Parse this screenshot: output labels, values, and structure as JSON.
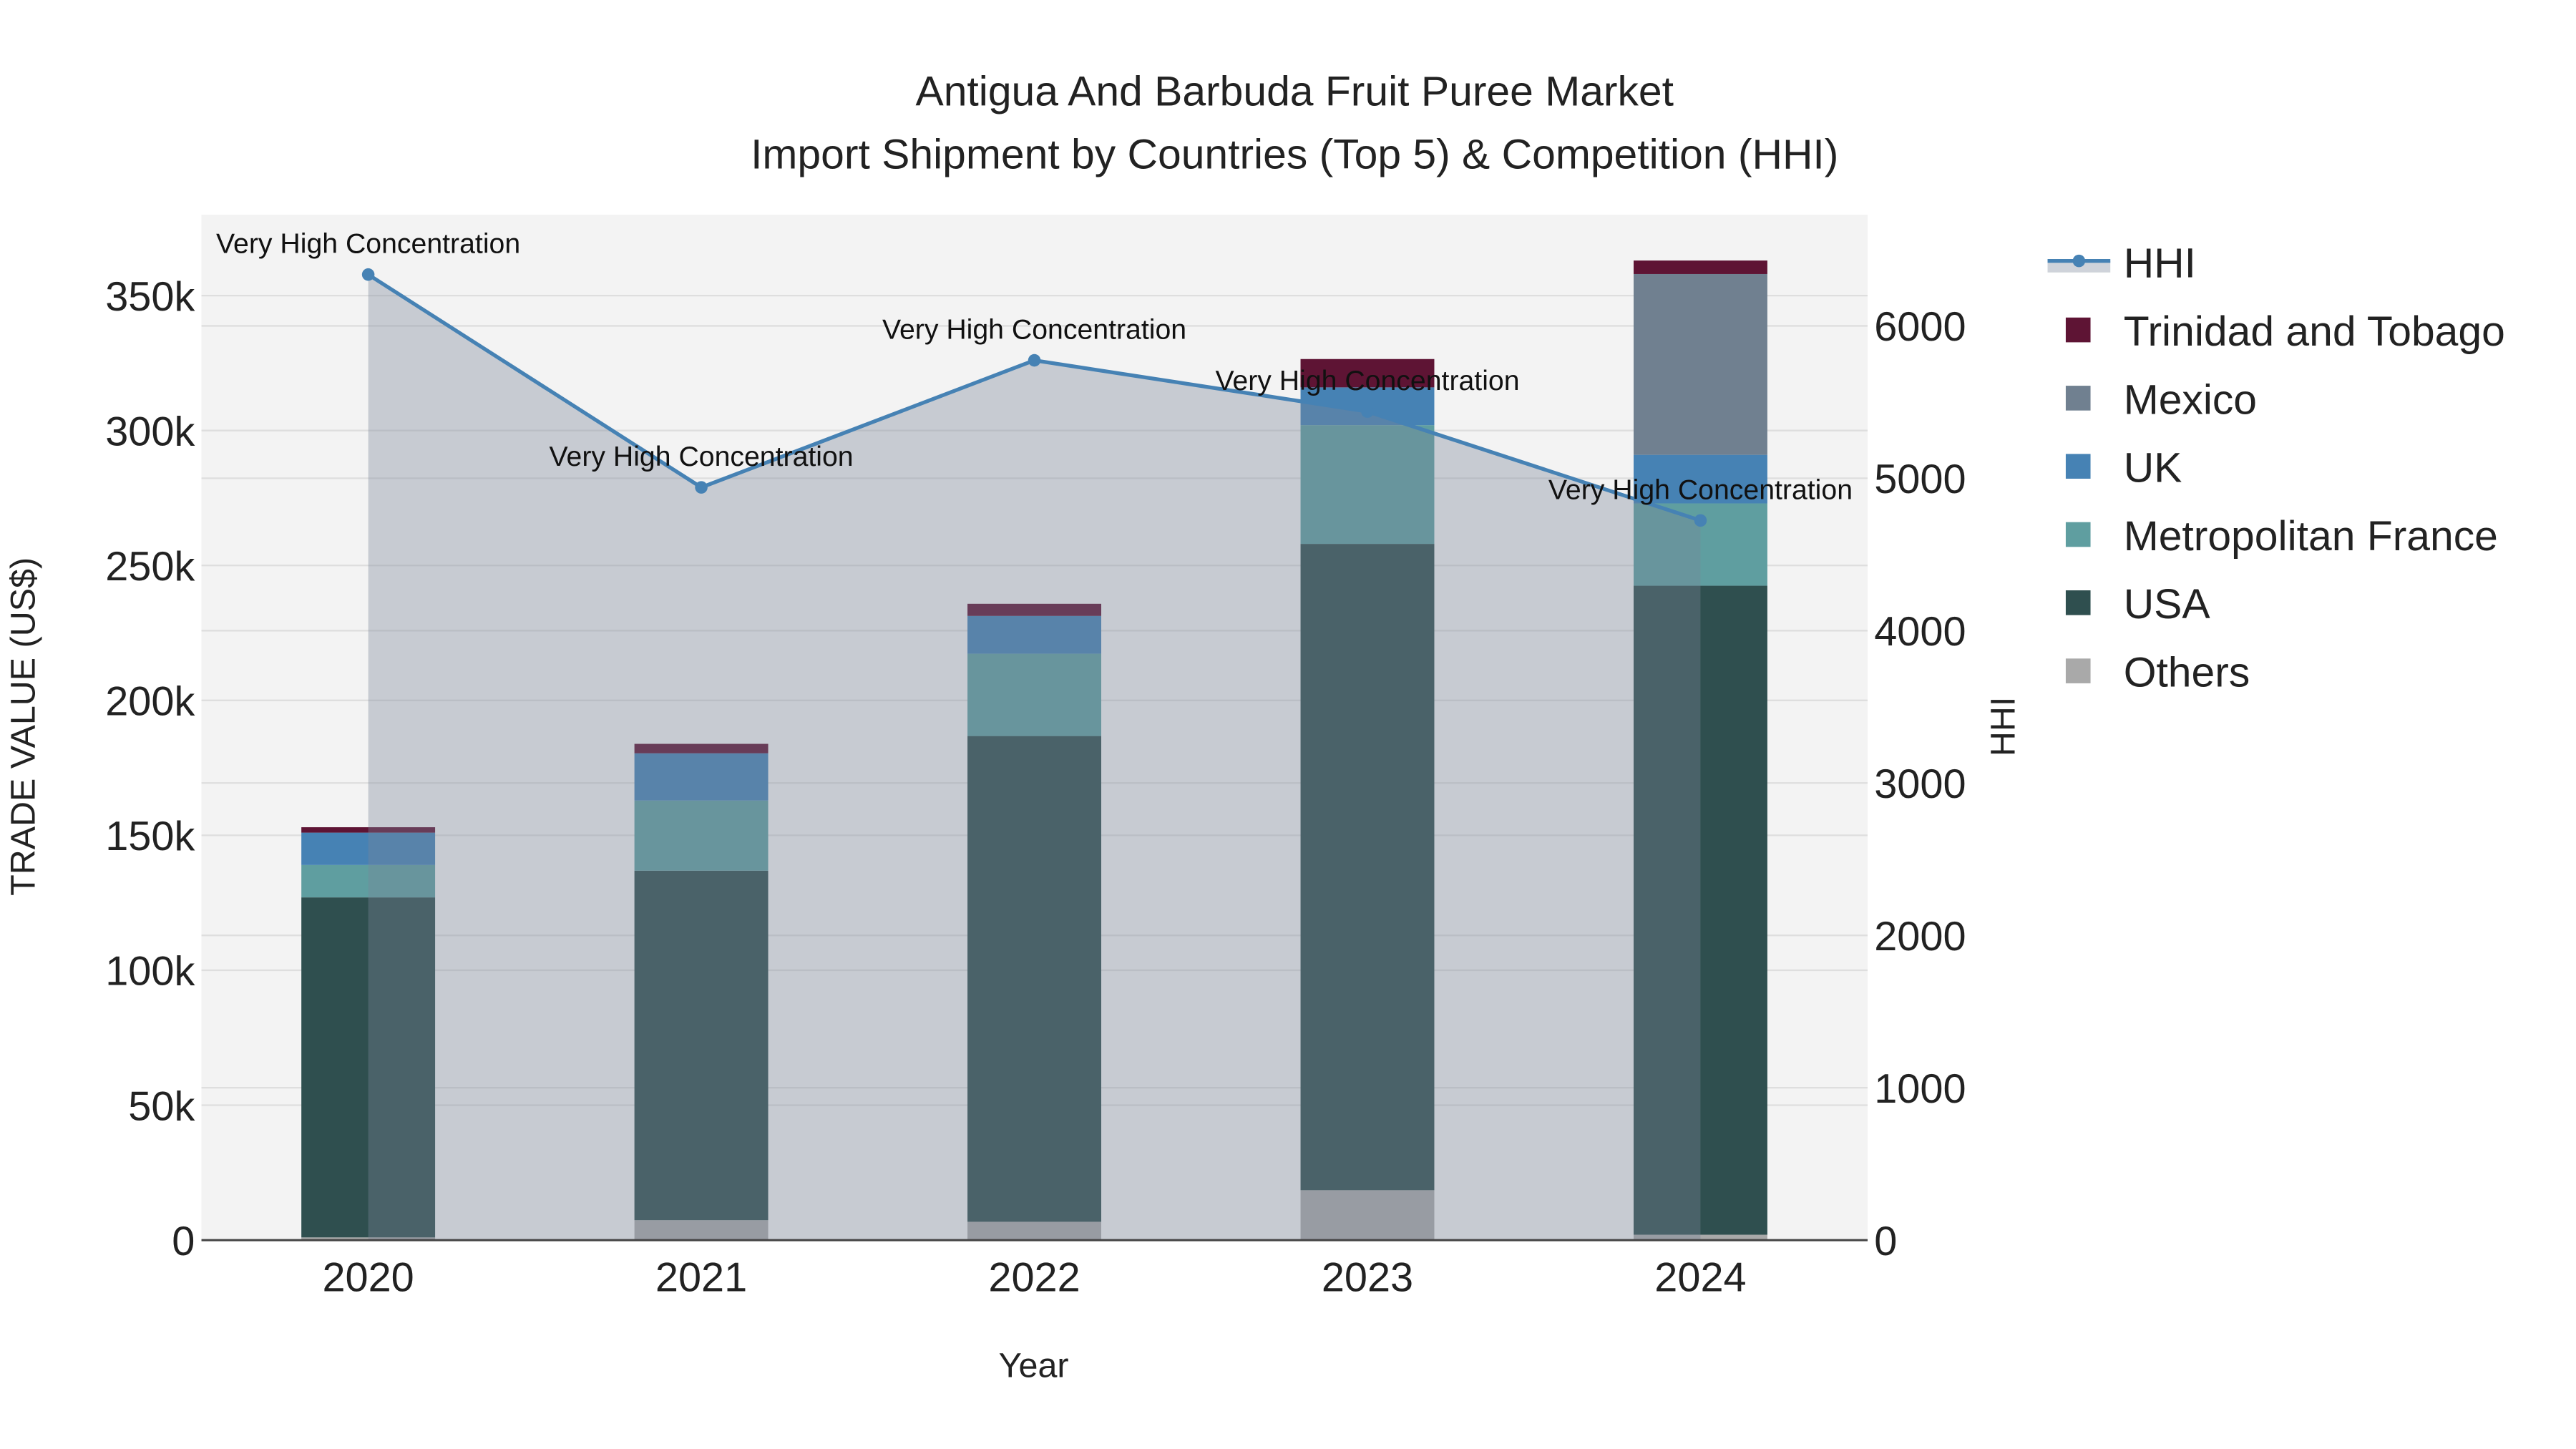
{
  "chart_data": {
    "type": "bar",
    "title_line1": "Antigua And Barbuda Fruit Puree Market",
    "title_line2": "Import Shipment by Countries (Top 5) & Competition (HHI)",
    "xlabel": "Year",
    "ylabel": "TRADE VALUE (US$)",
    "y2label": "HHI",
    "categories": [
      "2020",
      "2021",
      "2022",
      "2023",
      "2024"
    ],
    "ylim": [
      0,
      380000
    ],
    "y2lim": [
      0,
      6730
    ],
    "yticks": [
      0,
      50000,
      100000,
      150000,
      200000,
      250000,
      300000,
      350000
    ],
    "ytick_labels": [
      "0",
      "50k",
      "100k",
      "150k",
      "200k",
      "250k",
      "300k",
      "350k"
    ],
    "y2ticks": [
      0,
      1000,
      2000,
      3000,
      4000,
      5000,
      6000
    ],
    "y2tick_labels": [
      "0",
      "1000",
      "2000",
      "3000",
      "4000",
      "5000",
      "6000"
    ],
    "stacked": true,
    "series": [
      {
        "name": "Others",
        "color": "#a9a9a9",
        "values": [
          1000,
          7400,
          6800,
          18500,
          2000
        ]
      },
      {
        "name": "USA",
        "color": "#2f4f4f",
        "values": [
          126000,
          129500,
          180000,
          239500,
          240500
        ]
      },
      {
        "name": "Metropolitan France",
        "color": "#5f9ea0",
        "values": [
          12000,
          26000,
          30500,
          44000,
          30500
        ]
      },
      {
        "name": "UK",
        "color": "#4682b4",
        "values": [
          12000,
          17500,
          14000,
          14000,
          18000
        ]
      },
      {
        "name": "Mexico",
        "color": "#708090",
        "values": [
          0,
          0,
          0,
          0,
          67000
        ]
      },
      {
        "name": "Trinidad and Tobago",
        "color": "#5e1434",
        "values": [
          2000,
          3500,
          4500,
          10500,
          5000
        ]
      }
    ],
    "hhi": {
      "name": "HHI",
      "color": "#4682b4",
      "values": [
        6337,
        4940,
        5774,
        5438,
        4723
      ],
      "annotations": [
        "Very High Concentration",
        "Very High Concentration",
        "Very High Concentration",
        "Very High Concentration",
        "Very High Concentration"
      ]
    },
    "legend_order": [
      "HHI",
      "Trinidad and Tobago",
      "Mexico",
      "UK",
      "Metropolitan France",
      "USA",
      "Others"
    ],
    "legend_placement": "right",
    "grid": true
  }
}
